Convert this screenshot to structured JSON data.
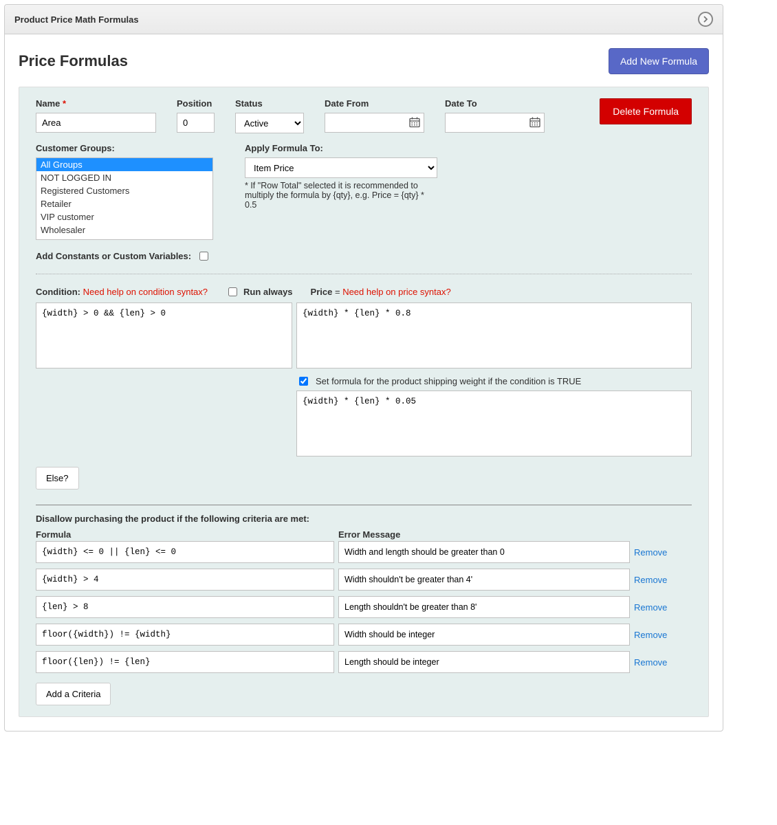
{
  "header": {
    "title": "Product Price Math Formulas"
  },
  "page": {
    "title": "Price Formulas",
    "add_button": "Add New Formula"
  },
  "labels": {
    "name": "Name",
    "position": "Position",
    "status": "Status",
    "date_from": "Date From",
    "date_to": "Date To",
    "delete": "Delete Formula",
    "customer_groups": "Customer Groups:",
    "apply_to": "Apply Formula To:",
    "apply_note": "* If \"Row Total\" selected it is recommended to multiply the formula by {qty}, e.g. Price = {qty} * 0.5",
    "constants": "Add Constants or Custom Variables:",
    "condition": "Condition:",
    "condition_help": "Need help on condition syntax?",
    "run_always": "Run always",
    "price": "Price",
    "price_equals": " = ",
    "price_help": "Need help on price syntax?",
    "shipping_weight": "Set formula for the product shipping weight if the condition is TRUE",
    "else": "Else?",
    "disallow": "Disallow purchasing the product if the following criteria are met:",
    "col_formula": "Formula",
    "col_error": "Error Message",
    "remove": "Remove",
    "add_criteria": "Add a Criteria"
  },
  "form": {
    "name": "Area",
    "position": "0",
    "status": "Active",
    "date_from": "",
    "date_to": "",
    "apply_to": "Item Price",
    "constants_checked": false,
    "run_always_checked": false,
    "condition": "{width} > 0 && {len} > 0",
    "price_formula": "{width} * {len} * 0.8",
    "shipping_checked": true,
    "shipping_formula": "{width} * {len} * 0.05"
  },
  "customer_groups": {
    "selected": 0,
    "options": [
      "All Groups",
      "NOT LOGGED IN",
      "Registered Customers",
      "Retailer",
      "VIP customer",
      "Wholesaler"
    ]
  },
  "criteria": [
    {
      "formula": "{width} <= 0 || {len} <= 0",
      "message": "Width and length should be greater than 0"
    },
    {
      "formula": "{width} > 4",
      "message": "Width shouldn't be greater than 4'"
    },
    {
      "formula": "{len} > 8",
      "message": "Length shouldn't be greater than 8'"
    },
    {
      "formula": "floor({width}) != {width}",
      "message": "Width should be integer"
    },
    {
      "formula": "floor({len}) != {len}",
      "message": "Length should be integer"
    }
  ]
}
